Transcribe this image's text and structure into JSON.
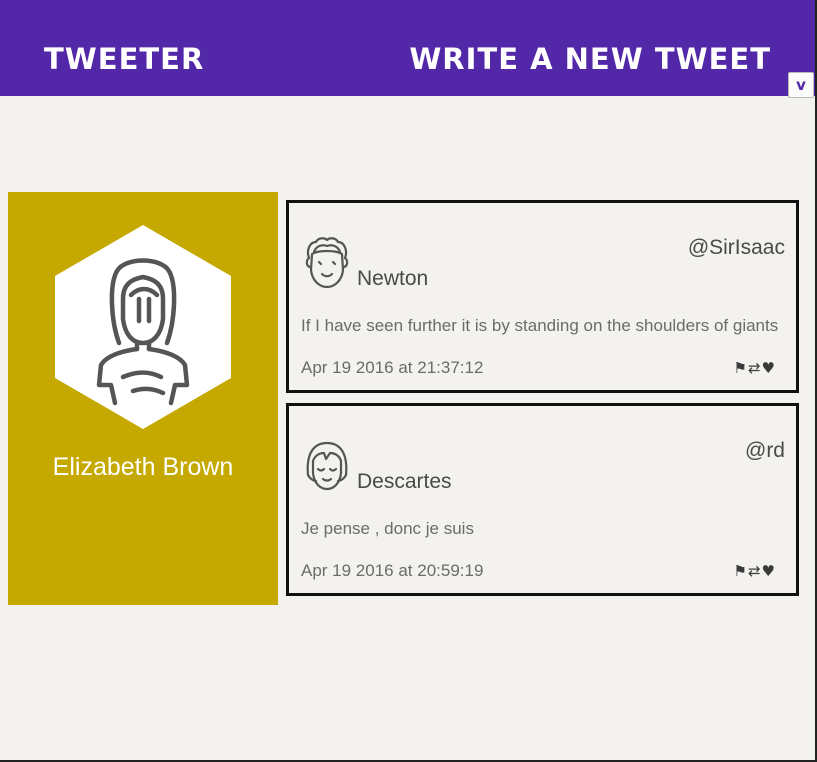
{
  "header": {
    "brand": "Tweeter",
    "compose_label": "Write a new tweet",
    "toggle_label": "v",
    "bg_color": "#5227a8"
  },
  "profile": {
    "name": "Elizabeth Brown",
    "avatar_icon": "woman-avatar-icon",
    "card_color": "#c6a900"
  },
  "tweets": [
    {
      "name": "Newton",
      "handle": "@SirIsaac",
      "avatar_icon": "curly-hair-man-avatar-icon",
      "text": "If I have seen further it is by standing on the shoulders of giants",
      "date": "Apr 19 2016 at 21:37:12",
      "actions": {
        "flag": "⚑",
        "retweet": "⇄",
        "like": "♥"
      }
    },
    {
      "name": "Descartes",
      "handle": "@rd",
      "avatar_icon": "bangs-avatar-icon",
      "text": "Je pense , donc je suis",
      "date": "Apr 19 2016 at 20:59:19",
      "actions": {
        "flag": "⚑",
        "retweet": "⇄",
        "like": "♥"
      }
    }
  ]
}
